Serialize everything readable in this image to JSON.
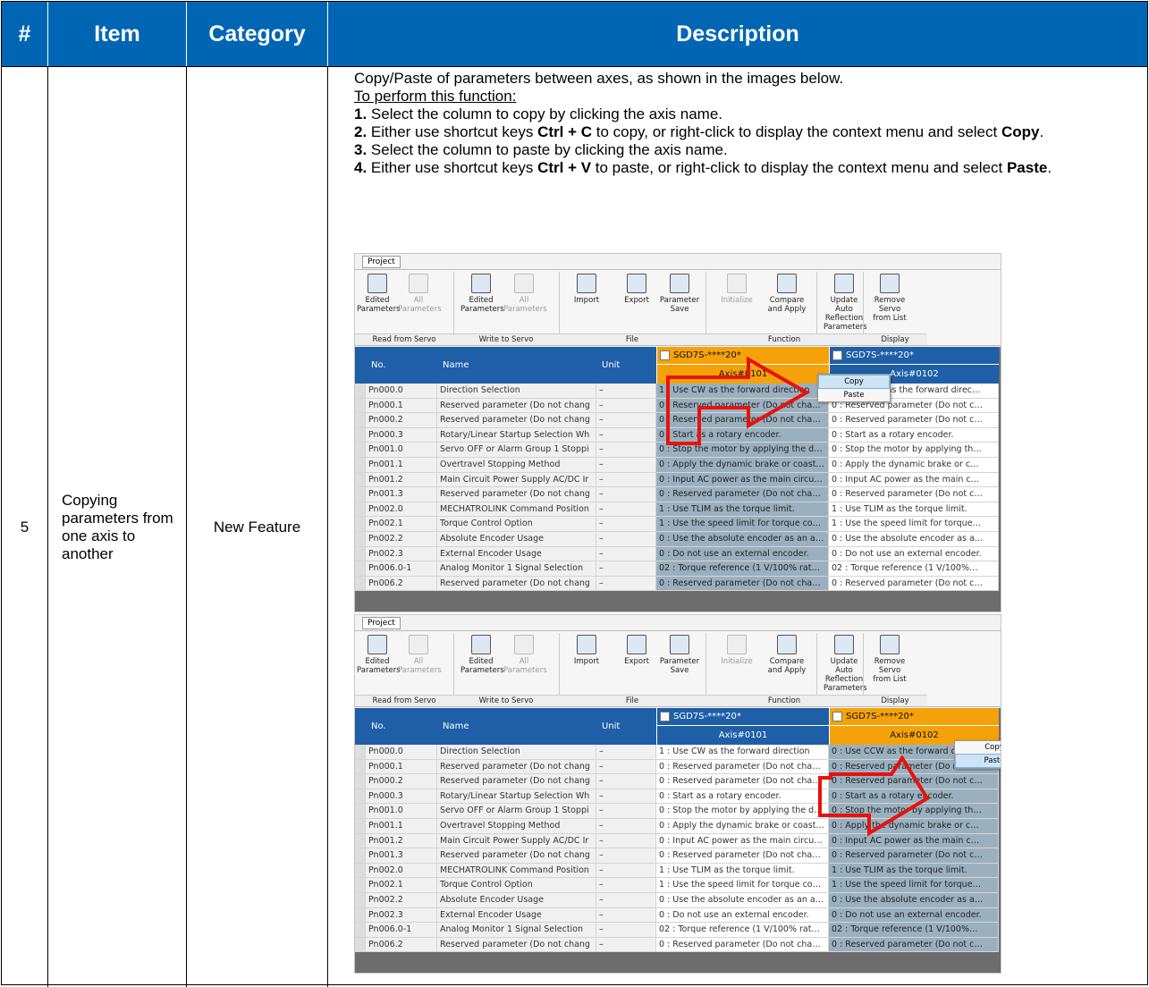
{
  "table": {
    "headers": [
      "#",
      "Item",
      "Category",
      "Description"
    ],
    "row": {
      "number": "5",
      "item": "Copying parameters from one axis to another",
      "category": "New Feature"
    }
  },
  "description": {
    "intro": "Copy/Paste of parameters between axes, as shown in the images below.",
    "perform_heading": "To perform this function:",
    "step1_num": "1.",
    "step1_text": " Select the column to copy by clicking the axis name.",
    "step2_num": "2.",
    "step2_a": " Either use shortcut keys ",
    "step2_keys": "Ctrl + C",
    "step2_b": " to copy, or right-click to display the context menu and select ",
    "step2_cmd": "Copy",
    "step2_end": ".",
    "step3_num": "3.",
    "step3_text": " Select the column to paste by clicking the axis name.",
    "step4_num": "4.",
    "step4_a": " Either use shortcut keys ",
    "step4_keys": "Ctrl + V",
    "step4_b": " to paste, or right-click to display the context menu and select ",
    "step4_cmd": "Paste",
    "step4_end": "."
  },
  "software": {
    "tab": "Project",
    "ribbon_buttons": [
      {
        "label": "Edited Parameters",
        "icon": "read-edited-icon",
        "enabled": true
      },
      {
        "label": "All Parameters",
        "icon": "read-all-icon",
        "enabled": false
      },
      {
        "label": "Edited Parameters",
        "icon": "write-edited-icon",
        "enabled": true
      },
      {
        "label": "All Parameters",
        "icon": "write-all-icon",
        "enabled": false
      },
      {
        "label": "Import",
        "icon": "import-icon",
        "enabled": true
      },
      {
        "label": "Export",
        "icon": "export-icon",
        "enabled": true
      },
      {
        "label": "Parameter Save",
        "icon": "parameter-save-icon",
        "enabled": true
      },
      {
        "label": "Initialize",
        "icon": "initialize-icon",
        "enabled": false
      },
      {
        "label": "Compare and Apply",
        "icon": "compare-apply-icon",
        "enabled": true
      },
      {
        "label": "Update Auto Reflection Parameters",
        "icon": "update-auto-icon",
        "enabled": true
      },
      {
        "label": "Remove Servo from List",
        "icon": "remove-servo-icon",
        "enabled": true
      }
    ],
    "ribbon_groups": [
      "Read from Servo",
      "Write to Servo",
      "File",
      "Function",
      "Display"
    ],
    "grid_headers": {
      "no": "No.",
      "name": "Name",
      "unit": "Unit"
    },
    "axis1": {
      "model": "SGD7S-****20*",
      "name": "Axis#0101"
    },
    "axis2": {
      "model": "SGD7S-****20*",
      "name": "Axis#0102"
    },
    "rows": [
      {
        "no": "Pn000.0",
        "name": "Direction Selection",
        "unit": "–",
        "a1": "1 : Use CW as the forward direction",
        "a2_before": "0 : Use CCW as the forward direc…"
      },
      {
        "no": "Pn000.1",
        "name": "Reserved parameter (Do not chang",
        "unit": "–",
        "a1": "0 : Reserved parameter (Do not cha…",
        "a2_before": "0 : Reserved parameter (Do not c…"
      },
      {
        "no": "Pn000.2",
        "name": "Reserved parameter (Do not chang",
        "unit": "–",
        "a1": "0 : Reserved parameter (Do not cha…",
        "a2_before": "0 : Reserved parameter (Do not c…"
      },
      {
        "no": "Pn000.3",
        "name": "Rotary/Linear Startup Selection Wh",
        "unit": "–",
        "a1": "0 : Start as a rotary encoder.",
        "a2_before": "0 : Start as a rotary encoder."
      },
      {
        "no": "Pn001.0",
        "name": "Servo OFF or Alarm Group 1 Stoppi",
        "unit": "–",
        "a1": "0 : Stop the motor by applying the d…",
        "a2_before": "0 : Stop the motor by applying th…"
      },
      {
        "no": "Pn001.1",
        "name": "Overtravel Stopping Method",
        "unit": "–",
        "a1": "0 : Apply the dynamic brake or coast…",
        "a2_before": "0 : Apply the dynamic brake or c…"
      },
      {
        "no": "Pn001.2",
        "name": "Main Circuit Power Supply AC/DC Ir",
        "unit": "–",
        "a1": "0 : Input AC power as the main circu…",
        "a2_before": "0 : Input AC power as the main c…"
      },
      {
        "no": "Pn001.3",
        "name": "Reserved parameter (Do not chang",
        "unit": "–",
        "a1": "0 : Reserved parameter (Do not cha…",
        "a2_before": "0 : Reserved parameter (Do not c…"
      },
      {
        "no": "Pn002.0",
        "name": "MECHATROLINK Command Position",
        "unit": "–",
        "a1": "1 : Use TLIM as the torque limit.",
        "a2_before": "1 : Use TLIM as the torque limit."
      },
      {
        "no": "Pn002.1",
        "name": "Torque Control Option",
        "unit": "–",
        "a1": "1 : Use the speed limit for torque co…",
        "a2_before": "1 : Use the speed limit for torque…"
      },
      {
        "no": "Pn002.2",
        "name": "Absolute Encoder Usage",
        "unit": "–",
        "a1": "0 : Use the absolute encoder as an a…",
        "a2_before": "0 : Use the absolute encoder as a…"
      },
      {
        "no": "Pn002.3",
        "name": "External Encoder Usage",
        "unit": "–",
        "a1": "0 : Do not use an external encoder.",
        "a2_before": "0 : Do not use an external encoder."
      },
      {
        "no": "Pn006.0-1",
        "name": "Analog Monitor 1 Signal Selection",
        "unit": "–",
        "a1": "02 : Torque reference (1 V/100% rat…",
        "a2_before": "02 : Torque reference (1 V/100%…"
      },
      {
        "no": "Pn006.2",
        "name": "Reserved parameter (Do not chang",
        "unit": "–",
        "a1": "0 : Reserved parameter (Do not cha…",
        "a2_before": "0 : Reserved parameter (Do not c…"
      }
    ],
    "context_menu_copy": [
      "Copy",
      "Paste"
    ],
    "context_menu_paste": [
      "Copy",
      "Paste"
    ]
  },
  "colors": {
    "header_blue": "#0066b3",
    "arrow_red": "#e8120c",
    "selected_axis": "#f5a20a"
  }
}
